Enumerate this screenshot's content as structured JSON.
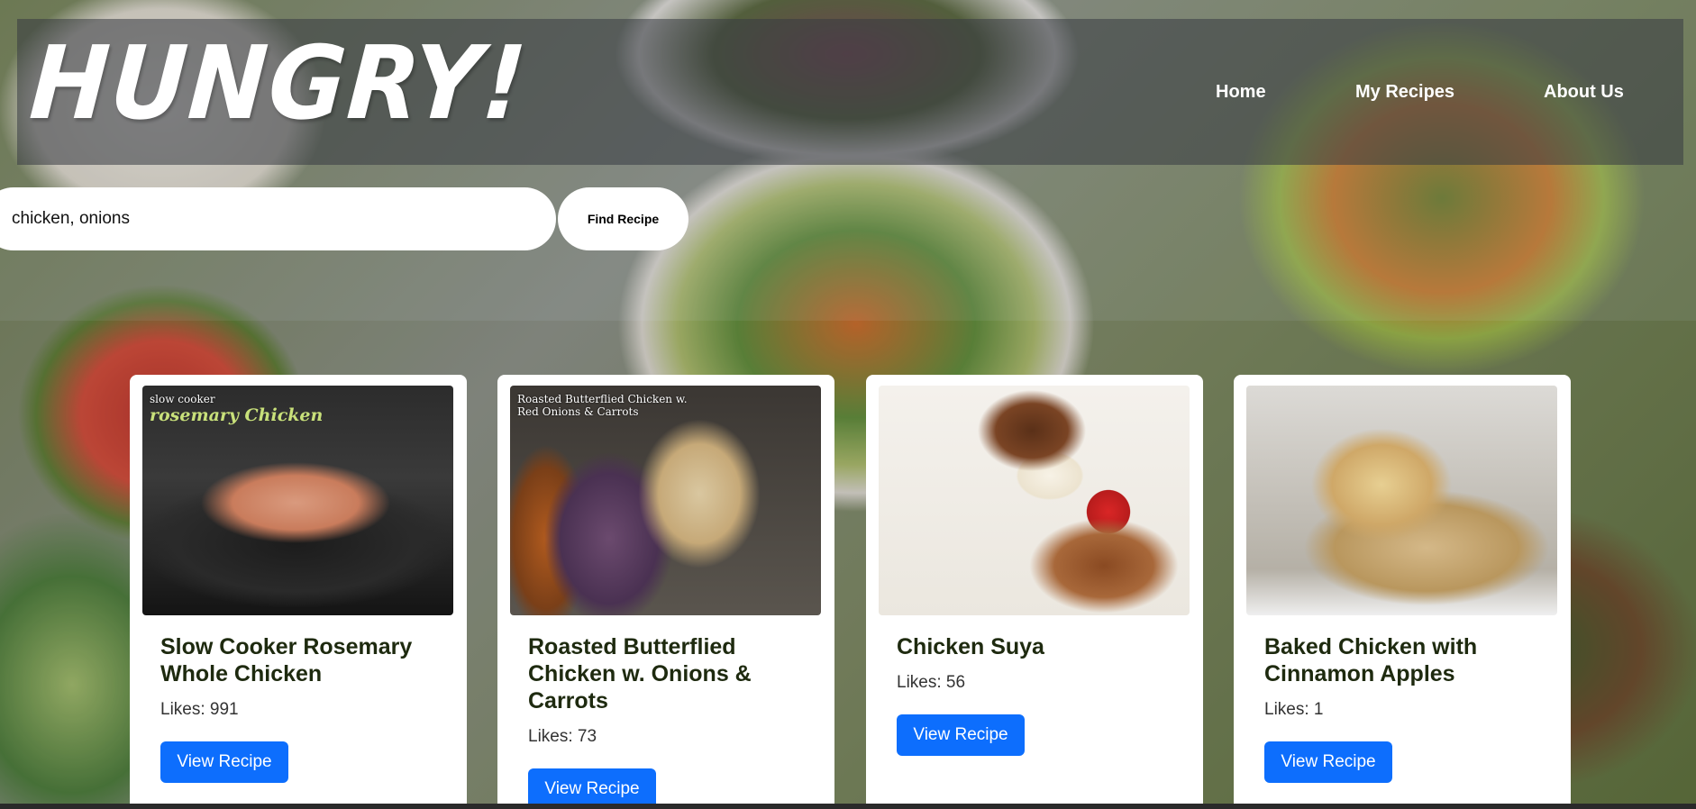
{
  "header": {
    "logo": "HUNGRY!",
    "nav": [
      {
        "label": "Home"
      },
      {
        "label": "My Recipes"
      },
      {
        "label": "About Us"
      }
    ]
  },
  "search": {
    "value": "chicken, onions",
    "button_label": "Find Recipe"
  },
  "recipes": [
    {
      "title": "Slow Cooker Rosemary Whole Chicken",
      "likes": "Likes: 991",
      "button_label": "View Recipe",
      "image_text_small": "slow cooker",
      "image_text_large": "rosemary Chicken"
    },
    {
      "title": "Roasted Butterflied Chicken w. Onions & Carrots",
      "likes": "Likes: 73",
      "button_label": "View Recipe",
      "image_text_small": "Roasted Butterflied Chicken w. Red Onions & Carrots"
    },
    {
      "title": "Chicken Suya",
      "likes": "Likes: 56",
      "button_label": "View Recipe"
    },
    {
      "title": "Baked Chicken with Cinnamon Apples",
      "likes": "Likes: 1",
      "button_label": "View Recipe"
    }
  ]
}
